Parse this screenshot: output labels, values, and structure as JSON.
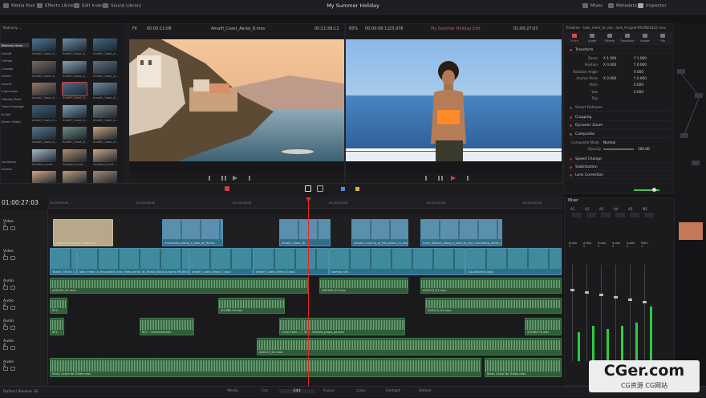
{
  "topbar": {
    "left": [
      "Media Pool",
      "Effects Library",
      "Edit Index",
      "Sound Library"
    ],
    "title": "My Summer Holiday",
    "right": [
      "Mixer",
      "Metadata",
      "Inspector"
    ]
  },
  "media_pool": {
    "bin_title": "Balcony ...",
    "bins": [
      "Balcony View",
      "Amalfi",
      "Climbs",
      "Crowds",
      "Drone",
      "Sports",
      "Interviews",
      "Holiday Reel",
      "Stock Footage",
      "B-Roll",
      "Drone Shots"
    ],
    "clip_names": [
      "Amalfi_Coast_A...",
      "Amalfi_Coast_A...",
      "Amalfi_Coast_A...",
      "Amalfi_Coast_A...",
      "Amalfi_Coast_A...",
      "Amalfi_Coast_A...",
      "Amalfi_Coast_A...",
      "Amalfi_Coast_A...",
      "Amalfi_Coast_A...",
      "Amalfi_Coast_A...",
      "Amalfi_Coast_A...",
      "Amalfi_Coast_A...",
      "Amalfi_Coast_A...",
      "Amalfi_Coast_A...",
      "Amalfi_Coast_A...",
      "Seafood_Land...",
      "Seafood_Land...",
      "Seafood_Land...",
      "Seafood_Land...",
      "Seafood_Land...",
      "Seafood_Land..."
    ],
    "bottom_labels": [
      "Locations",
      "Events"
    ]
  },
  "source_viewer": {
    "zoom": "Fit",
    "timecode_left": "00:00:11:08",
    "clip": "Amalfi_Coast_Aerial_8.mov",
    "timecode_right": "00:11:58:12"
  },
  "timeline_viewer": {
    "zoom": "83%",
    "duration": "00:00:06:11",
    "fps": "23.976",
    "timeline": "My Summer Holiday Edit",
    "timecode": "01:00:27:03"
  },
  "inspector": {
    "header": "Timeline - lake_meet_to_mo...lack_A-rigrid-PRORES422.mov",
    "tabs": [
      "Video",
      "Audio",
      "Effects",
      "Transition",
      "Image",
      "File"
    ],
    "sections": [
      {
        "name": "Transform",
        "open": true
      },
      {
        "name": "Smart Reframe",
        "open": false
      },
      {
        "name": "Cropping",
        "open": false
      },
      {
        "name": "Dynamic Zoom",
        "open": false
      },
      {
        "name": "Composite",
        "open": true
      },
      {
        "name": "Speed Change",
        "open": false
      },
      {
        "name": "Stabilization",
        "open": false
      },
      {
        "name": "Lens Correction",
        "open": false
      }
    ],
    "params": [
      {
        "label": "Zoom",
        "x": "X  1.000",
        "y": "Y  1.000"
      },
      {
        "label": "Position",
        "x": "X  0.000",
        "y": "Y  0.000"
      },
      {
        "label": "Rotation Angle",
        "x": "",
        "y": "0.000"
      },
      {
        "label": "Anchor Point",
        "x": "X  0.000",
        "y": "Y  0.000"
      },
      {
        "label": "Pitch",
        "x": "",
        "y": "0.000"
      },
      {
        "label": "Yaw",
        "x": "",
        "y": "0.000"
      },
      {
        "label": "Flip",
        "x": "",
        "y": ""
      }
    ],
    "composite_mode_label": "Composite Mode",
    "composite_mode": "Normal",
    "opacity_label": "Opacity",
    "opacity": "100.00"
  },
  "timeline": {
    "timecode": "01:00:27:03",
    "ruler": [
      "01:00:00:00",
      "01:00:08:00",
      "01:00:16:00",
      "01:00:24:00",
      "01:00:32:00",
      "01:00:40:00",
      "01:00:48:00"
    ],
    "tracks": [
      "Video 2",
      "Video 1",
      "Audio 1",
      "Audio 2",
      "Audio 3",
      "Audio 4",
      "Audio 5"
    ],
    "video2_clips": [
      "Lower 3rd Simple Underline",
      "mountains_along_a_lake_by_Roma...",
      "Amalfi_Coast_Te...",
      "people_running_at_the_beach_in_long...",
      "fresh_flowers_along_a_lake_by_the_mountains_aerial_by_Roma..."
    ],
    "video1_clips": [
      "Tourist_Talent_S...",
      "lake_meet_to_mountains_and_trees_aerial_by_Roma_Black-A-rigrid-PRORES4...",
      "Amalfi_Coast_Aerial_7.mov",
      "Amalfi_Coast_Aerial_8.mov",
      "woman_sitt...",
      "Clip-dissolve-long"
    ],
    "audio_clips": [
      "A001D2_01.mov",
      "A001D2_01.mov",
      "A001C3_01.mov",
      "SFX - ...",
      "SOUND FX.wav",
      "A001C3_01.mov",
      "SFX - ...",
      "SFX - Overhead.wav",
      "Cross Fade...",
      "SFX - Distant_props_pa.wav",
      "SOUND FX.wav",
      "A001C3_01.mov",
      "Music Score for Trailer.mov",
      "Music Score for Trailer.mov"
    ]
  },
  "mixer": {
    "title": "Mixer",
    "channels": [
      "A1",
      "A2",
      "A3",
      "A4",
      "A5",
      "M1"
    ],
    "strips": [
      "Audio 1",
      "Audio 2",
      "Audio 3",
      "Audio 4",
      "Audio 5",
      "Main 1"
    ],
    "levels": [
      0.45,
      0.55,
      0.5,
      0.55,
      0.6,
      0.85
    ]
  },
  "pages": [
    "Media",
    "Cut",
    "Edit",
    "Fusion",
    "Color",
    "Fairlight",
    "Deliver"
  ],
  "active_page": "Edit",
  "app_name": "DaVinci Resolve 18",
  "watermark": {
    "main": "CGer.com",
    "sub": "CG资源  CG网站"
  }
}
